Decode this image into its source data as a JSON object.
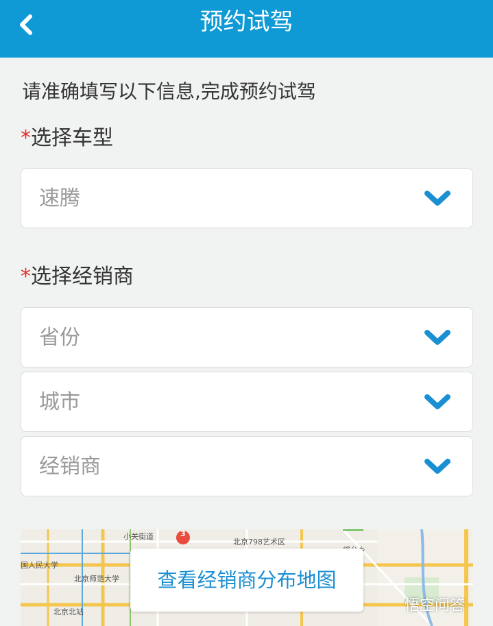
{
  "header": {
    "title": "预约试驾",
    "back_icon": "chevron-left-icon"
  },
  "intro_text": "请准确填写以下信息,完成预约试驾",
  "model_section": {
    "required_mark": "*",
    "label": "选择车型",
    "selected_value": "速腾"
  },
  "dealer_section": {
    "required_mark": "*",
    "label": "选择经销商",
    "province_placeholder": "省份",
    "city_placeholder": "城市",
    "dealer_placeholder": "经销商"
  },
  "map": {
    "button_label": "查看经销商分布地图",
    "labels": {
      "l1": "小关街道",
      "l2": "北京798艺术区",
      "l3": "国人民大学",
      "l4": "北京师范大学",
      "l5": "北京北站",
      "l6": "将台乡"
    },
    "marker_number": "3"
  },
  "watermark": "悟空问答",
  "colors": {
    "accent": "#0f9ad6",
    "required": "#e0302a",
    "chevron": "#1a8fd1"
  }
}
